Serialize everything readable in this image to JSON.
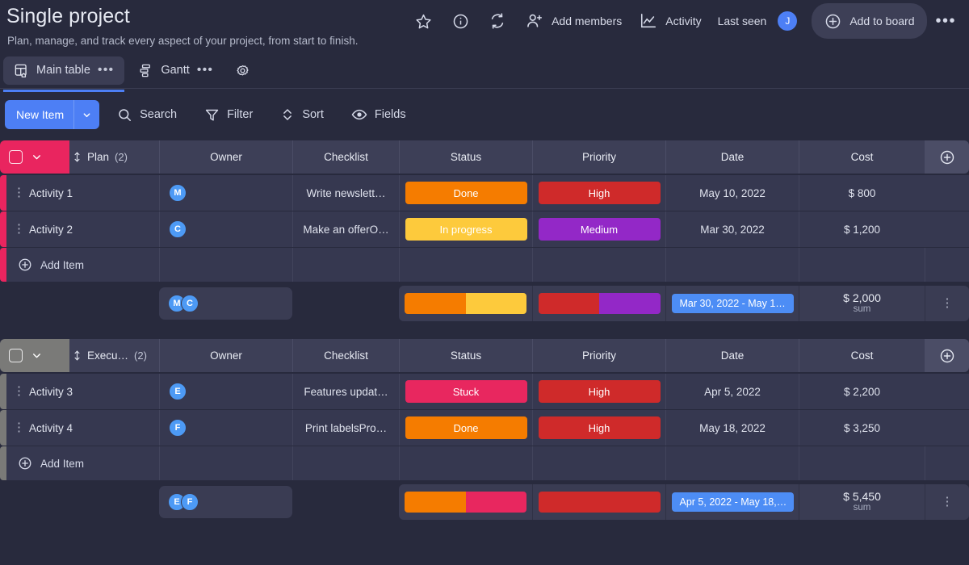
{
  "header": {
    "title": "Single project",
    "subtitle": "Plan, manage, and track every aspect of your project, from start to finish.",
    "favorite_icon": "star-icon",
    "info_icon": "info-icon",
    "refresh_icon": "refresh-icon",
    "add_members_label": "Add members",
    "activity_label": "Activity",
    "last_seen_label": "Last seen",
    "last_seen_avatar": "J",
    "add_to_board_label": "Add to board",
    "more_label": "•••"
  },
  "tabs": {
    "items": [
      {
        "label": "Main table",
        "icon": "table-home-icon",
        "active": true,
        "menu": "•••"
      },
      {
        "label": "Gantt",
        "icon": "gantt-icon",
        "active": false,
        "menu": "•••"
      }
    ],
    "settings_icon": "gear-icon"
  },
  "toolbar": {
    "new_item_label": "New Item",
    "search_label": "Search",
    "filter_label": "Filter",
    "sort_label": "Sort",
    "fields_label": "Fields"
  },
  "columns": [
    "Owner",
    "Checklist",
    "Status",
    "Priority",
    "Date",
    "Cost"
  ],
  "colors": {
    "accent": "#4d7ff5",
    "group_plan": "#e9255f",
    "group_execution": "#7a7a78",
    "status_done": "#f57c00",
    "status_in_progress": "#fdca3c",
    "status_stuck": "#e8275f",
    "priority_high": "#cf2a2a",
    "priority_medium": "#9328c7",
    "date_pill": "#4d8df5"
  },
  "groups": [
    {
      "name": "Plan",
      "count": "(2)",
      "color": "#e9255f",
      "add_item_label": "Add Item",
      "rows": [
        {
          "title": "Activity 1",
          "owner": "M",
          "checklist": "Write newslett…",
          "status": "Done",
          "status_color": "#f57c00",
          "priority": "High",
          "priority_color": "#cf2a2a",
          "date": "May 10, 2022",
          "cost": "$ 800"
        },
        {
          "title": "Activity 2",
          "owner": "C",
          "checklist": "Make an offerO…",
          "status": "In progress",
          "status_color": "#fdca3c",
          "priority": "Medium",
          "priority_color": "#9328c7",
          "date": "Mar 30, 2022",
          "cost": "$ 1,200"
        }
      ],
      "summary": {
        "owners": [
          "M",
          "C"
        ],
        "status_segments": [
          {
            "color": "#f57c00",
            "pct": 50
          },
          {
            "color": "#fdca3c",
            "pct": 50
          }
        ],
        "priority_segments": [
          {
            "color": "#cf2a2a",
            "pct": 50
          },
          {
            "color": "#9328c7",
            "pct": 50
          }
        ],
        "date_range": "Mar 30, 2022 - May 1…",
        "cost_value": "$ 2,000",
        "cost_unit": "sum"
      }
    },
    {
      "name": "Execu…",
      "count": "(2)",
      "color": "#7a7a78",
      "add_item_label": "Add Item",
      "rows": [
        {
          "title": "Activity 3",
          "owner": "E",
          "checklist": "Features updat…",
          "status": "Stuck",
          "status_color": "#e8275f",
          "priority": "High",
          "priority_color": "#cf2a2a",
          "date": "Apr 5, 2022",
          "cost": "$ 2,200"
        },
        {
          "title": "Activity 4",
          "owner": "F",
          "checklist": "Print labelsPro…",
          "status": "Done",
          "status_color": "#f57c00",
          "priority": "High",
          "priority_color": "#cf2a2a",
          "date": "May 18, 2022",
          "cost": "$ 3,250"
        }
      ],
      "summary": {
        "owners": [
          "E",
          "F"
        ],
        "status_segments": [
          {
            "color": "#f57c00",
            "pct": 50
          },
          {
            "color": "#e8275f",
            "pct": 50
          }
        ],
        "priority_segments": [
          {
            "color": "#cf2a2a",
            "pct": 100
          }
        ],
        "date_range": "Apr 5, 2022 - May 18,…",
        "cost_value": "$ 5,450",
        "cost_unit": "sum"
      }
    }
  ]
}
